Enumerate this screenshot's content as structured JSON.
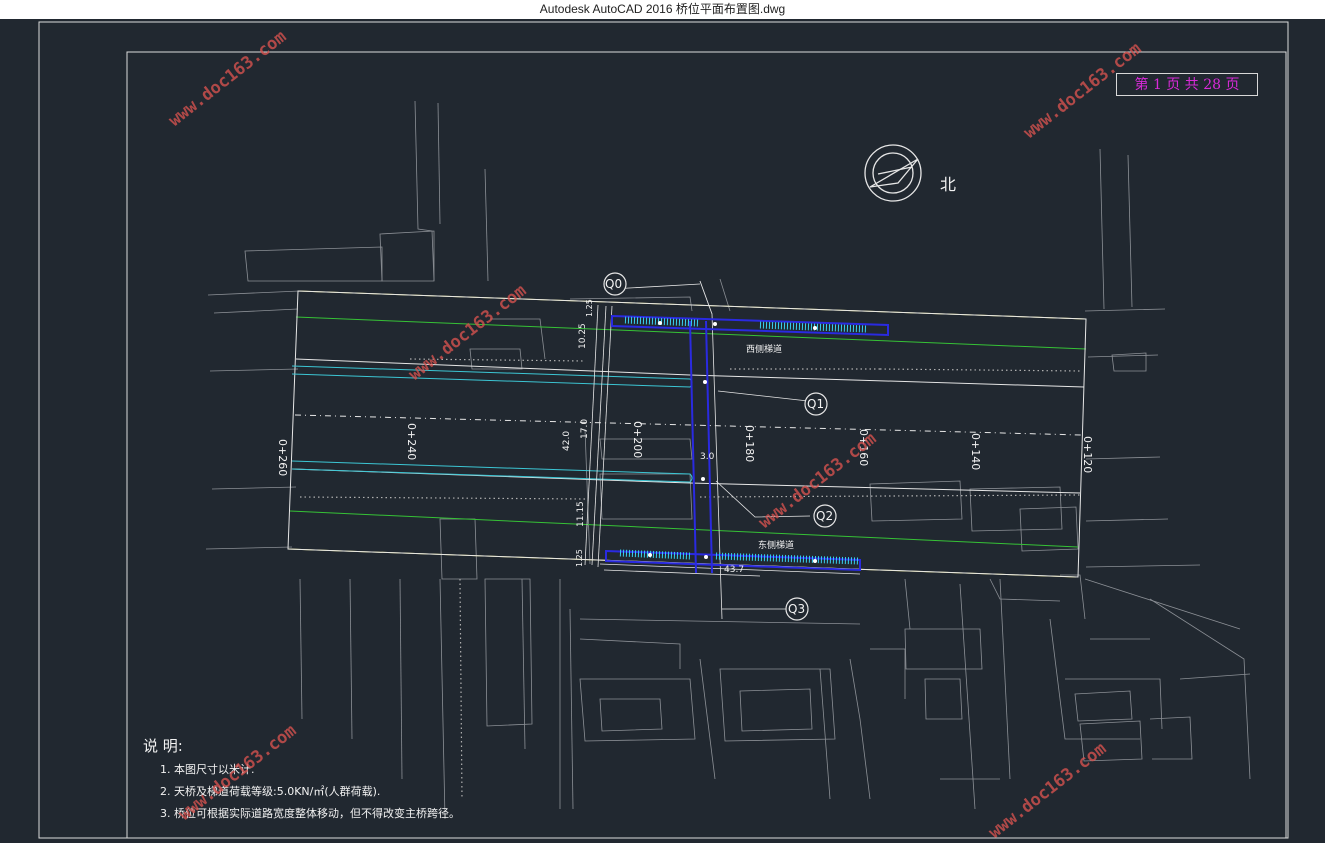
{
  "window": {
    "title": "Autodesk AutoCAD 2016     桥位平面布置图.dwg"
  },
  "page_indicator": "第 1 页 共 28 页",
  "watermark": "www.doc163.com",
  "compass": {
    "label": "北"
  },
  "labels": {
    "q0": "Q0",
    "q1": "Q1",
    "q2": "Q2",
    "q3": "Q3",
    "west_stair": "西侧梯道",
    "east_stair": "东侧梯道",
    "dim_width": "43.7",
    "dim_left_1": "10.25",
    "dim_left_2": "42.0",
    "dim_left_3": "17.0",
    "dim_left_4": "11.15",
    "dim_center": "3.0",
    "dim_top": "1.25",
    "dim_bottom": "1.25"
  },
  "stations": [
    "0+260",
    "0+240",
    "0+200",
    "0+180",
    "0+160",
    "0+140",
    "0+120"
  ],
  "notes": {
    "heading": "说  明:",
    "items": [
      "1. 本图尺寸以米计.",
      "2. 天桥及梯道荷载等级:5.0KN/㎡(人群荷载).",
      "3. 桥位可根据实际道路宽度整体移动，但不得改变主桥跨径。"
    ]
  },
  "colors": {
    "background": "#212830",
    "road_edge_yellow": "#e8e060",
    "green_line": "#36c236",
    "cyan_line": "#3cc6d4",
    "bridge_blue": "#2a2ae0",
    "stair_cyan": "#3ad0f0",
    "watermark": "#d9534f",
    "page_magenta": "#d82ad8"
  }
}
